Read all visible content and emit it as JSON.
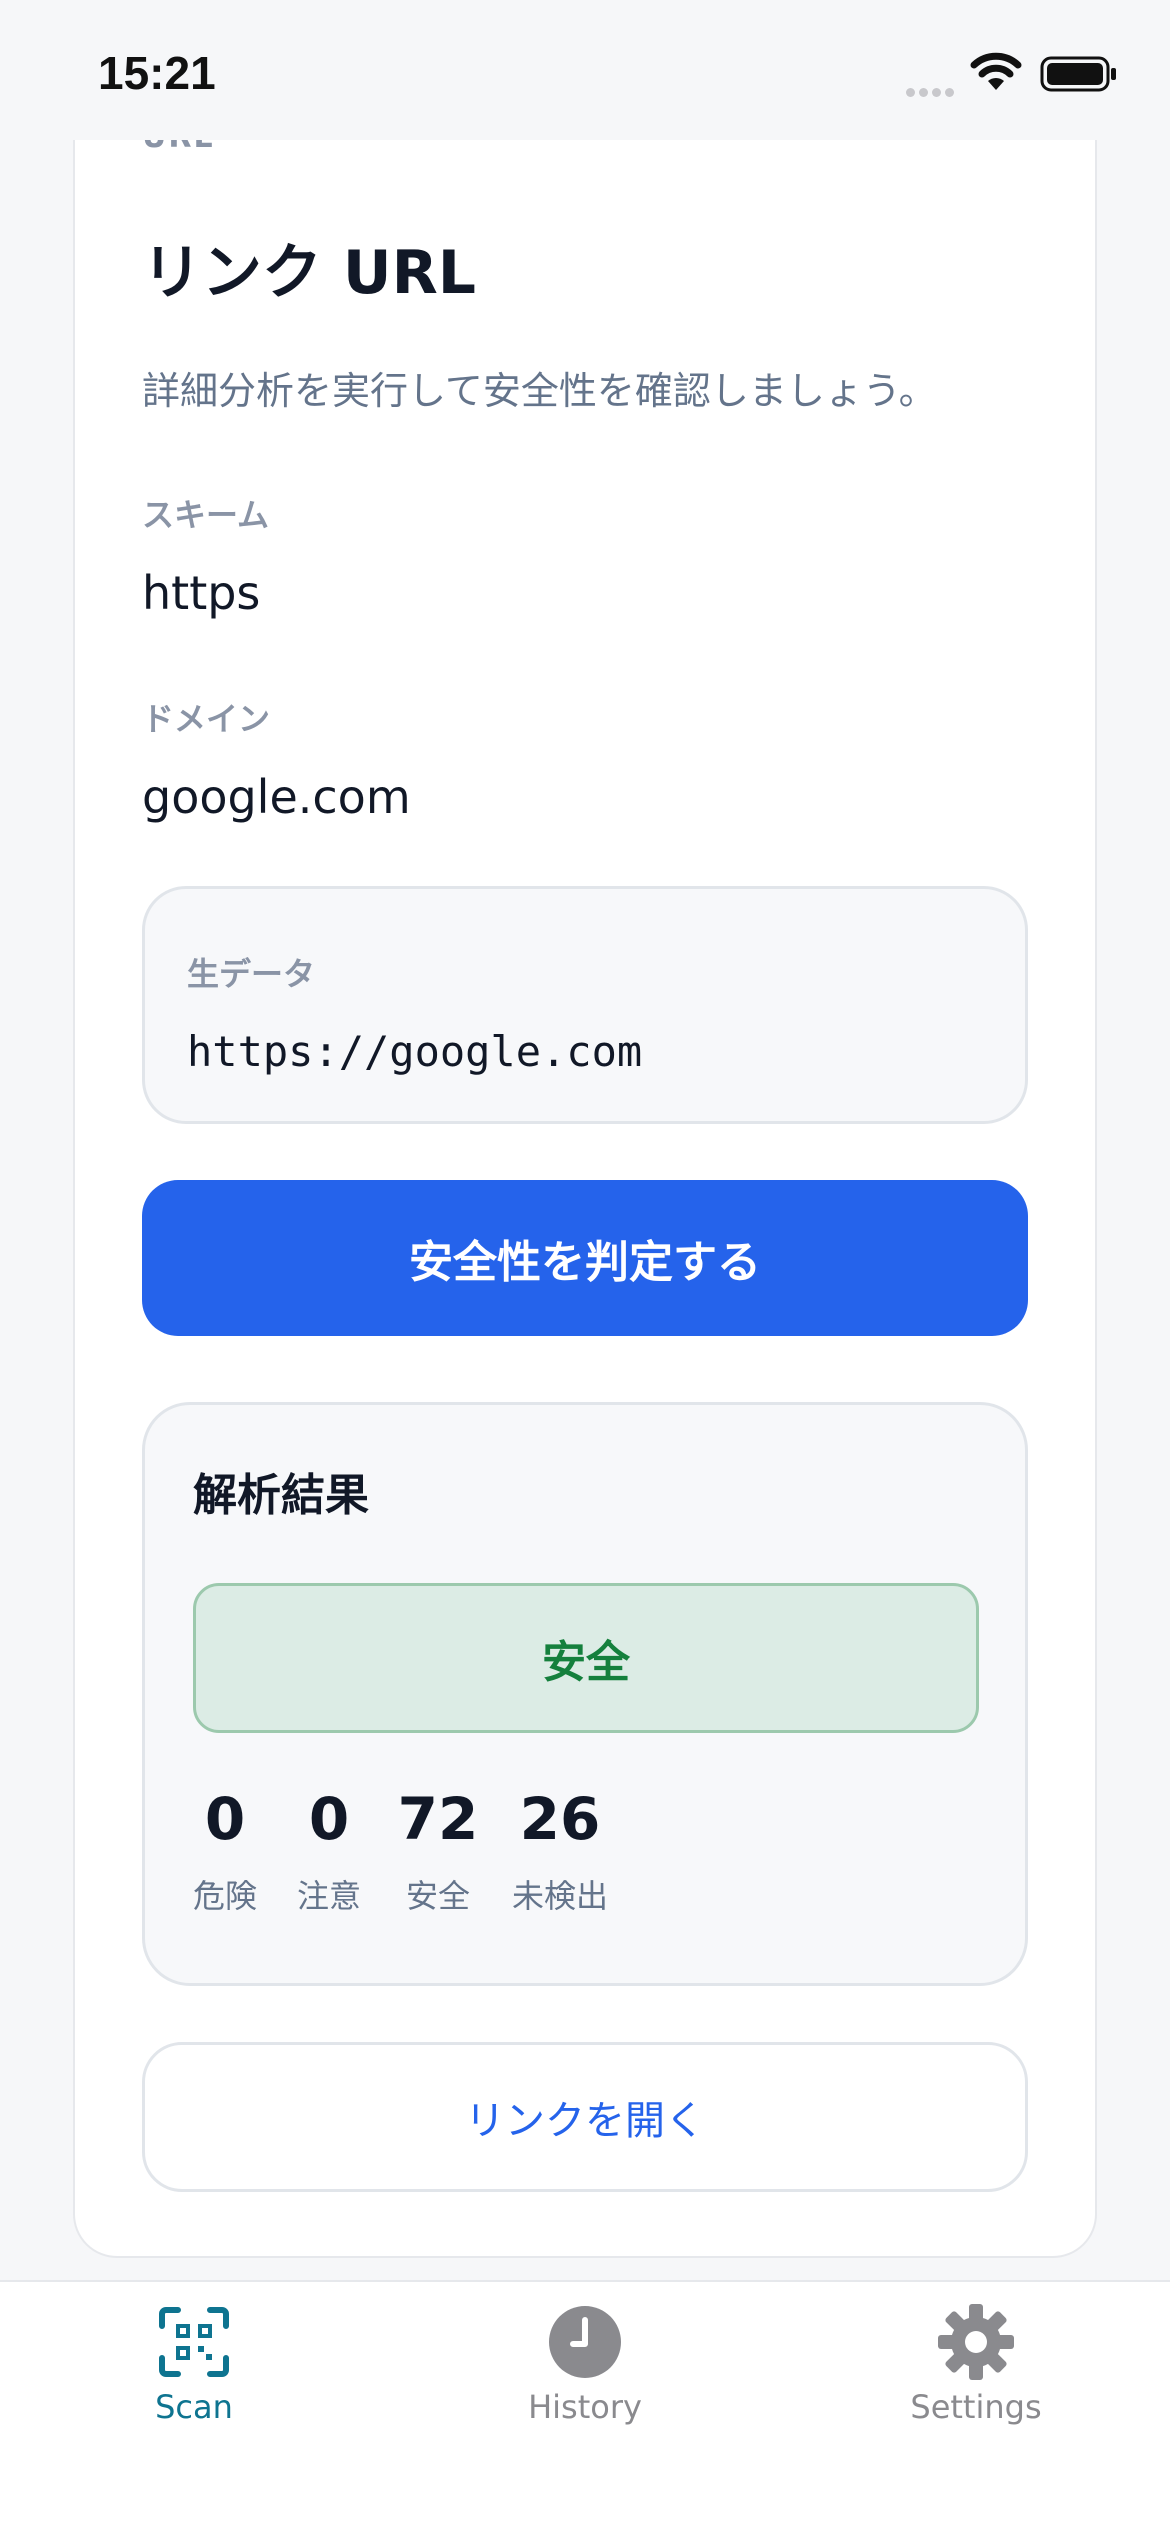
{
  "status": {
    "time": "15:21"
  },
  "detail": {
    "section_tag": "URL",
    "title": "リンク URL",
    "subtitle": "詳細分析を実行して安全性を確認しましょう。",
    "scheme_label": "スキーム",
    "scheme_value": "https",
    "domain_label": "ドメイン",
    "domain_value": "google.com",
    "raw_label": "生データ",
    "raw_value": "https://google.com",
    "check_button": "安全性を判定する"
  },
  "result": {
    "title": "解析結果",
    "verdict": "安全",
    "stats": [
      {
        "value": "0",
        "label": "危険"
      },
      {
        "value": "0",
        "label": "注意"
      },
      {
        "value": "72",
        "label": "安全"
      },
      {
        "value": "26",
        "label": "未検出"
      }
    ],
    "verdict_color": "#15803d"
  },
  "open_link_button": "リンクを開く",
  "tabs": [
    {
      "label": "Scan",
      "icon": "qr-scan-icon",
      "active": true
    },
    {
      "label": "History",
      "icon": "clock-icon",
      "active": false
    },
    {
      "label": "Settings",
      "icon": "gear-icon",
      "active": false
    }
  ],
  "colors": {
    "accent": "#2563eb",
    "tab_active": "#0e7490"
  }
}
